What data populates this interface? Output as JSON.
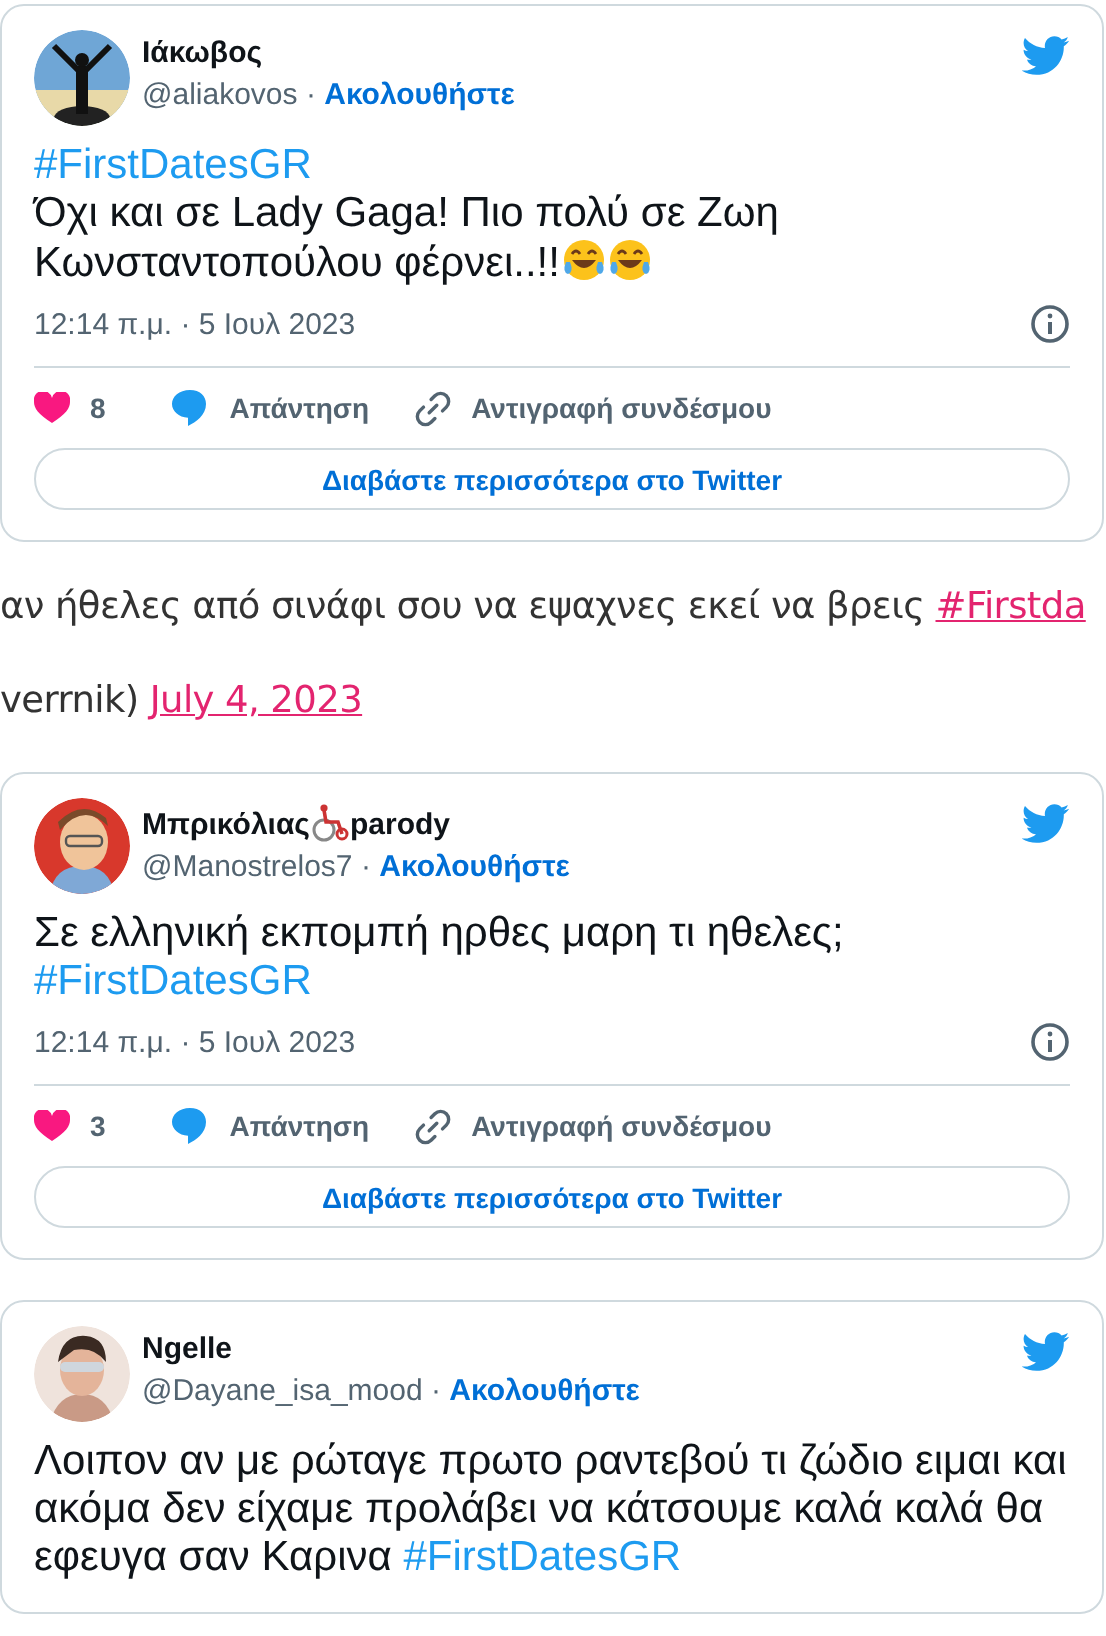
{
  "tweets": [
    {
      "name": [
        {
          "kind": "text",
          "text": "Ιάκωβος"
        }
      ],
      "handle": "@aliakovos",
      "separator": "·",
      "follow": "Ακολουθήστε",
      "lines": [
        [
          {
            "kind": "hashtag",
            "text": "#FirstDatesGR"
          }
        ],
        [
          {
            "kind": "text",
            "text": "Όχι και σε Lady Gaga! Πιο πολύ σε Ζωη Κωνσταντοπούλου φέρνει..!!"
          },
          {
            "kind": "emoji"
          },
          {
            "kind": "emoji"
          }
        ]
      ],
      "time": "12:14 π.μ. · 5 Ιουλ 2023",
      "likes": "8",
      "reply": "Απάντηση",
      "copy": "Αντιγραφή συνδέσμου",
      "more": "Διαβάστε περισσότερα στο Twitter"
    },
    {
      "kind": "blog",
      "lines": [
        [
          {
            "kind": "text",
            "text": "αν ήθελες από σινάφι σου να εψαχνες εκεί να βρεις"
          },
          {
            "kind": "link",
            "text": "#Firstda"
          }
        ],
        [
          {
            "kind": "text",
            "text": "verrnik)"
          },
          {
            "kind": "link",
            "text": "July 4, 2023"
          }
        ]
      ]
    },
    {
      "name": [
        {
          "kind": "text",
          "text": "Μπρικόλιας"
        },
        {
          "kind": "emoji"
        },
        {
          "kind": "text",
          "text": "parody"
        }
      ],
      "handle": "@Manostrelos7",
      "separator": "·",
      "follow": "Ακολουθήστε",
      "lines": [
        [
          {
            "kind": "text",
            "text": "Σε ελληνική εκπομπή ηρθες μαρη τι ηθελες;"
          }
        ],
        [
          {
            "kind": "hashtag",
            "text": "#FirstDatesGR"
          }
        ]
      ],
      "time": "12:14 π.μ. · 5 Ιουλ 2023",
      "likes": "3",
      "reply": "Απάντηση",
      "copy": "Αντιγραφή συνδέσμου",
      "more": "Διαβάστε περισσότερα στο Twitter"
    },
    {
      "name": [
        {
          "kind": "text",
          "text": "Ngelle"
        }
      ],
      "handle": "@Dayane_isa_mood",
      "separator": "·",
      "follow": "Ακολουθήστε",
      "lines": [
        [
          {
            "kind": "text",
            "text": "Λοιπον αν με ρώταγε πρωτο ραντεβού τι ζώδιο ειμαι και ακόμα δεν είχαμε προλάβει να κάτσουμε καλά καλά θα εφευγα σαν Καρινα "
          },
          {
            "kind": "hashtag",
            "text": "#FirstDatesGR"
          }
        ]
      ]
    }
  ]
}
